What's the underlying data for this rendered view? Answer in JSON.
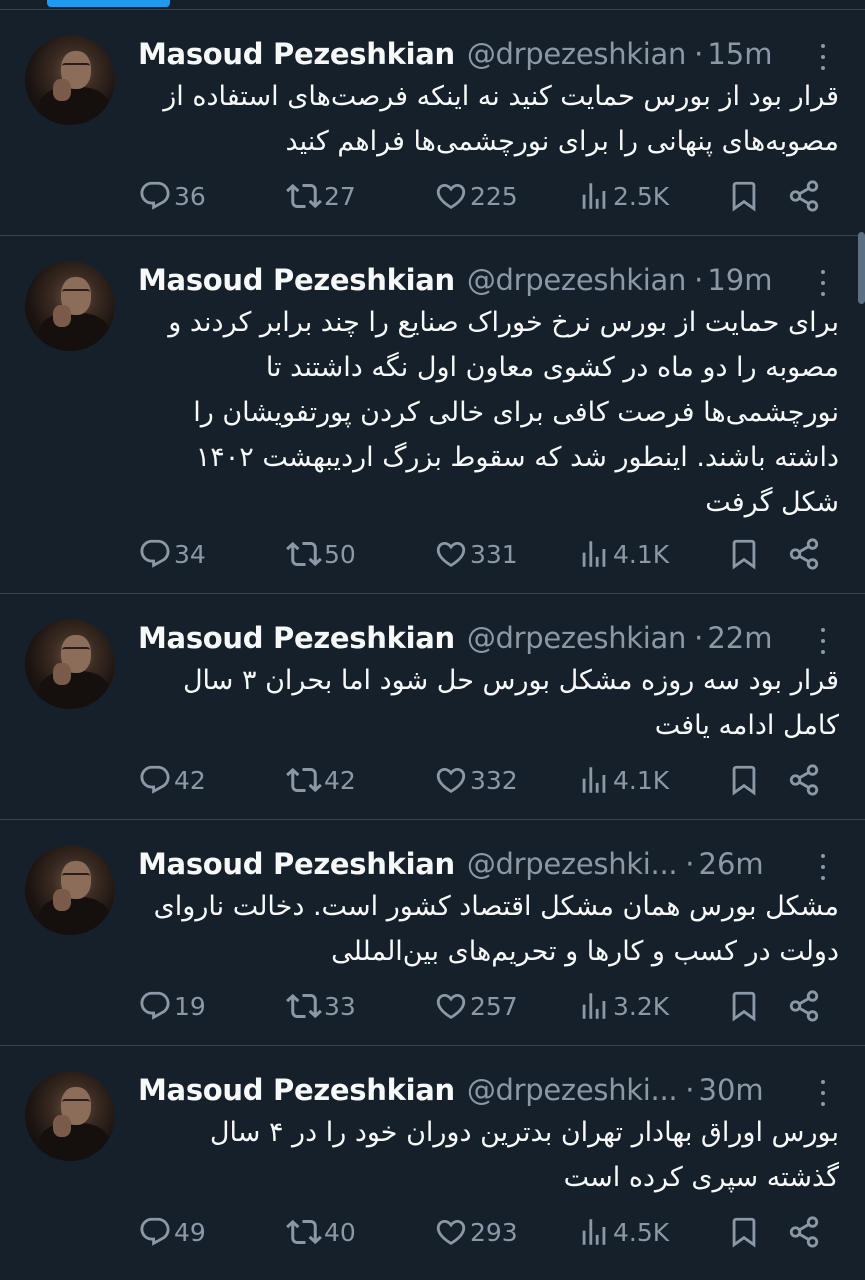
{
  "tweets": [
    {
      "name": "Masoud Pezeshkian",
      "handle": "@drpezeshkian",
      "separator": "·",
      "time": "15m",
      "text": "قرار بود از بورس حمایت کنید نه اینکه فرصت‌های استفاده از مصوبه‌های پنهانی را برای نورچشمی‌ها فراهم کنید",
      "replies": "36",
      "retweets": "27",
      "likes": "225",
      "views": "2.5K"
    },
    {
      "name": "Masoud Pezeshkian",
      "handle": "@drpezeshkian",
      "separator": "·",
      "time": "19m",
      "text": "برای حمایت از بورس نرخ خوراک صنایع را چند برابر کردند و مصوبه را دو ماه در کشوی معاون اول نگه داشتند تا نورچشمی‌ها فرصت کافی برای خالی کردن پورتفویشان را داشته باشند. اینطور شد که سقوط بزرگ اردیبهشت ۱۴۰۲ شکل گرفت",
      "replies": "34",
      "retweets": "50",
      "likes": "331",
      "views": "4.1K"
    },
    {
      "name": "Masoud Pezeshkian",
      "handle": "@drpezeshkian",
      "separator": "·",
      "time": "22m",
      "text": "قرار بود سه روزه مشکل بورس حل شود اما بحران ۳ سال کامل ادامه یافت",
      "replies": "42",
      "retweets": "42",
      "likes": "332",
      "views": "4.1K"
    },
    {
      "name": "Masoud Pezeshkian",
      "handle": "@drpezeshki...",
      "separator": "·",
      "time": "26m",
      "text": "مشکل بورس همان مشکل اقتصاد کشور است. دخالت ناروای دولت در کسب و کارها و تحریم‌های بین‌المللی",
      "replies": "19",
      "retweets": "33",
      "likes": "257",
      "views": "3.2K"
    },
    {
      "name": "Masoud Pezeshkian",
      "handle": "@drpezeshki...",
      "separator": "·",
      "time": "30m",
      "text": "بورس اوراق بهادار تهران بدترین دوران خود را در ۴ سال گذشته سپری کرده است",
      "replies": "49",
      "retweets": "40",
      "likes": "293",
      "views": "4.5K"
    }
  ],
  "colors": {
    "background": "#15202b",
    "text": "#f7f9f9",
    "secondary": "#8b98a5",
    "divider": "#38444d",
    "accent": "#1d9bf0"
  },
  "icons": [
    "more-icon",
    "reply-icon",
    "retweet-icon",
    "like-icon",
    "views-icon",
    "bookmark-icon",
    "share-icon"
  ]
}
